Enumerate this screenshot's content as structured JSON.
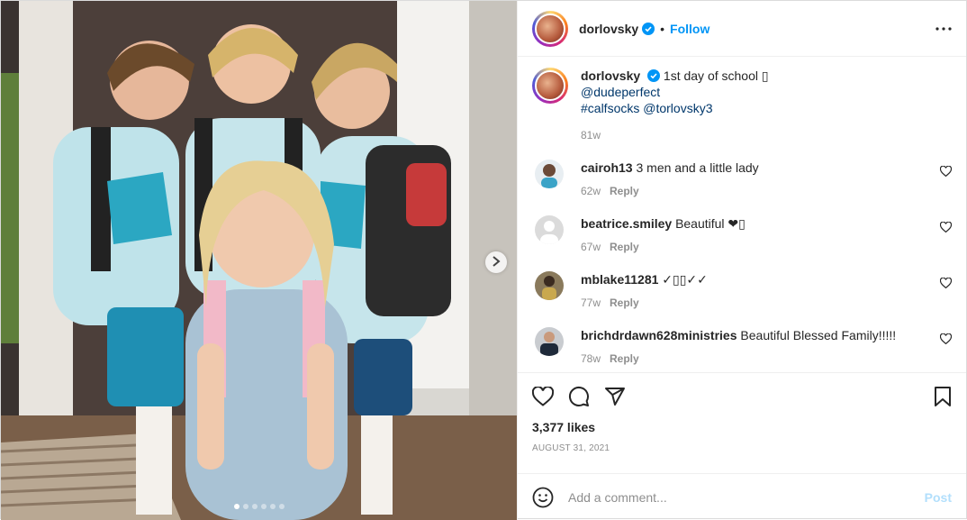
{
  "header": {
    "username": "dorlovsky",
    "separator": "•",
    "follow_label": "Follow"
  },
  "caption": {
    "username": "dorlovsky",
    "text": "1st day of school ▯",
    "mention_1": "@dudeperfect",
    "hashtag": "#calfsocks",
    "mention_2": "@torlovsky3",
    "time": "81w"
  },
  "comments": [
    {
      "username": "cairoh13",
      "text": "3 men and a little lady",
      "time": "62w",
      "reply_label": "Reply"
    },
    {
      "username": "beatrice.smiley",
      "text": "Beautiful ❤▯",
      "time": "67w",
      "reply_label": "Reply"
    },
    {
      "username": "mblake11281",
      "text": "✓▯▯✓✓",
      "time": "77w",
      "reply_label": "Reply"
    },
    {
      "username": "brichdrdawn628ministries",
      "text": "Beautiful Blessed Family!!!!!",
      "time": "78w",
      "reply_label": "Reply"
    }
  ],
  "likes": "3,377 likes",
  "date": "August 31, 2021",
  "add_comment": {
    "placeholder": "Add a comment...",
    "post_label": "Post"
  },
  "carousel": {
    "slides": 6,
    "active": 1
  },
  "colors": {
    "accent": "#0095f6",
    "verified": "#0095f6",
    "post_disabled": "#b2dffc",
    "muted": "#8e8e8e"
  },
  "icons": [
    "verified-badge-icon",
    "more-options-icon",
    "heart-icon",
    "comment-icon",
    "share-icon",
    "bookmark-icon",
    "emoji-icon",
    "chevron-right-icon"
  ]
}
